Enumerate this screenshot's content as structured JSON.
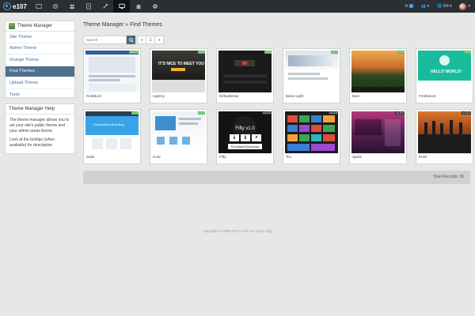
{
  "app": {
    "brand": "e107"
  },
  "topbar": {
    "nav_icons": [
      "dashboard-icon",
      "settings-icon",
      "users-icon",
      "content-icon",
      "tools-icon",
      "appearance-icon",
      "home-icon",
      "plugin-icon"
    ],
    "mail_badge": "1",
    "language": "EN"
  },
  "sidebar": {
    "title": "Theme Manager",
    "items": [
      {
        "label": "Site Theme"
      },
      {
        "label": "Admin Theme"
      },
      {
        "label": "Orange Theme"
      },
      {
        "label": "Find Themes",
        "active": true
      },
      {
        "label": "Upload Theme"
      },
      {
        "label": "Tools"
      }
    ]
  },
  "help": {
    "title": "Theme Manager Help",
    "p1": "The theme manager allows you to set your site's public theme and your admin areas theme.",
    "p2": "Look at the tooltips (when available) for description"
  },
  "main": {
    "breadcrumb": "Theme Manager » Find Themes",
    "search_placeholder": "Search",
    "pager": {
      "first": "«",
      "page": "1",
      "next": "»"
    },
    "themes": [
      {
        "name": "RoleBuzz",
        "version": "v2.0.1"
      },
      {
        "name": "Agency",
        "version": "v1.0"
      },
      {
        "name": "Defaultstrap",
        "version": "v1.0"
      },
      {
        "name": "Basic-Light",
        "version": "v1.0"
      },
      {
        "name": "Barn",
        "version": "v1.0"
      },
      {
        "name": "Freelancer",
        "version": "v1.0"
      },
      {
        "name": "Solid",
        "version": "v1.0"
      },
      {
        "name": "Core",
        "version": "v1.0"
      },
      {
        "name": "Fifty",
        "version": "v1.0.0"
      },
      {
        "name": "Tex",
        "version": "v1.0.0"
      },
      {
        "name": "Spark",
        "version": "v1.0.0"
      },
      {
        "name": "Rush",
        "version": "v1.0.0"
      }
    ],
    "fifty_overlay": {
      "title": "Fifty v1.0",
      "action_label": "Purchase/Download"
    },
    "total_records": "Total Records: 36"
  },
  "footer": {
    "text": "Copyright © 2008-2017 e107 Inc (e107.org)"
  }
}
